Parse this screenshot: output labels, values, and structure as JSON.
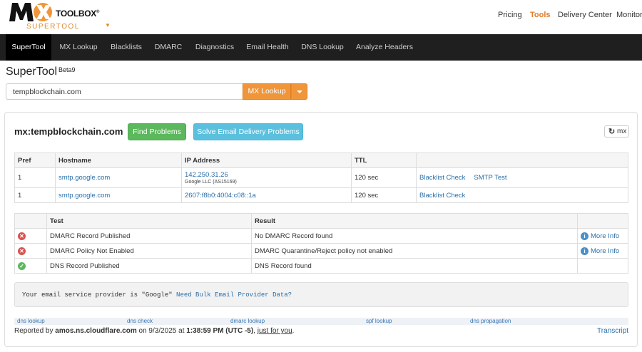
{
  "logo": {
    "mx": "MX",
    "toolbox": "TOOLBOX",
    "reg": "®",
    "supertool": "SUPERTOOL"
  },
  "topnav": [
    {
      "label": "Pricing",
      "active": false
    },
    {
      "label": "Tools",
      "active": true
    },
    {
      "label": "Delivery Center",
      "active": false
    },
    {
      "label": "Monitoring",
      "active": false
    }
  ],
  "mainnav": [
    "SuperTool",
    "MX Lookup",
    "Blacklists",
    "DMARC",
    "Diagnostics",
    "Email Health",
    "DNS Lookup",
    "Analyze Headers"
  ],
  "tool": {
    "title": "SuperTool",
    "beta": "Beta9",
    "search_value": "tempblockchain.com",
    "lookup_label": "MX Lookup"
  },
  "result": {
    "title": "mx:tempblockchain.com",
    "find_problems": "Find Problems",
    "solve": "Solve Email Delivery Problems",
    "refresh_label": "mx"
  },
  "mx_table": {
    "headers": [
      "Pref",
      "Hostname",
      "IP Address",
      "TTL",
      ""
    ],
    "rows": [
      {
        "pref": "1",
        "hostname": "smtp.google.com",
        "ip": "142.250.31.26",
        "ip_owner": "Google LLC (AS15169)",
        "ttl": "120 sec",
        "actions": [
          "Blacklist Check",
          "SMTP Test"
        ]
      },
      {
        "pref": "1",
        "hostname": "smtp.google.com",
        "ip": "2607:f8b0:4004:c08::1a",
        "ip_owner": "",
        "ttl": "120 sec",
        "actions": [
          "Blacklist Check"
        ]
      }
    ]
  },
  "test_table": {
    "headers": [
      "",
      "Test",
      "Result",
      ""
    ],
    "rows": [
      {
        "status": "error",
        "test": "DMARC Record Published",
        "result": "No DMARC Record found",
        "info": "More Info"
      },
      {
        "status": "error",
        "test": "DMARC Policy Not Enabled",
        "result": "DMARC Quarantine/Reject policy not enabled",
        "info": "More Info"
      },
      {
        "status": "ok",
        "test": "DNS Record Published",
        "result": "DNS Record found",
        "info": ""
      }
    ]
  },
  "notice": {
    "text": "Your email service provider is \"Google\"",
    "link": "Need Bulk Email Provider Data?"
  },
  "footer_links": [
    "dns lookup",
    "dns check",
    "dmarc lookup",
    "spf lookup",
    "dns propagation"
  ],
  "report": {
    "prefix": "Reported by",
    "server": "amos.ns.cloudflare.com",
    "on": "on 9/3/2025 at",
    "time": "1:38:59 PM (UTC -5)",
    "comma": ",",
    "just": "just for you",
    "dot": ".",
    "transcript": "Transcript"
  }
}
